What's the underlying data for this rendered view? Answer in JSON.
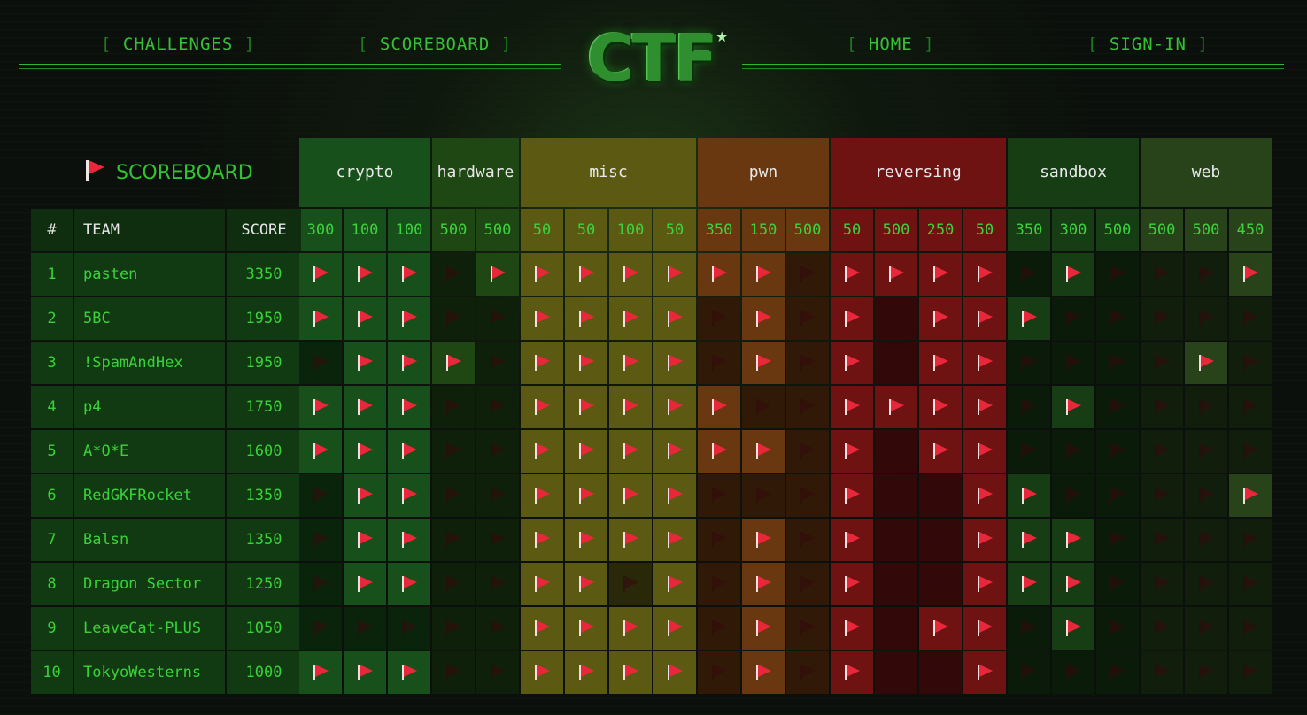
{
  "header": {
    "nav_left": [
      "CHALLENGES",
      "SCOREBOARD"
    ],
    "nav_right": [
      "HOME",
      "SIGN-IN"
    ],
    "logo_text": "CTF",
    "bracket_open": "[",
    "bracket_close": "]"
  },
  "scoreboard": {
    "title": "SCOREBOARD",
    "flag_icon": "red-flag-icon",
    "columns": {
      "rank": "#",
      "team": "TEAM",
      "score": "SCORE"
    },
    "categories": [
      {
        "name": "crypto",
        "points": [
          300,
          100,
          100
        ]
      },
      {
        "name": "hardware",
        "points": [
          500,
          500
        ]
      },
      {
        "name": "misc",
        "points": [
          50,
          50,
          100,
          50
        ]
      },
      {
        "name": "pwn",
        "points": [
          350,
          150,
          500
        ]
      },
      {
        "name": "reversing",
        "points": [
          50,
          500,
          250,
          50
        ]
      },
      {
        "name": "sandbox",
        "points": [
          350,
          300,
          500
        ]
      },
      {
        "name": "web",
        "points": [
          500,
          500,
          450
        ]
      }
    ],
    "rows": [
      {
        "rank": "1",
        "team": "pasten",
        "score": "3350",
        "solved": [
          1,
          1,
          1,
          0,
          1,
          1,
          1,
          1,
          1,
          1,
          1,
          0,
          1,
          1,
          1,
          1,
          0,
          1,
          0,
          0,
          0,
          1
        ]
      },
      {
        "rank": "2",
        "team": "5BC",
        "score": "1950",
        "solved": [
          1,
          1,
          1,
          0,
          0,
          1,
          1,
          1,
          1,
          0,
          1,
          0,
          1,
          0,
          1,
          1,
          1,
          0,
          0,
          0,
          0,
          0
        ]
      },
      {
        "rank": "3",
        "team": "!SpamAndHex",
        "score": "1950",
        "solved": [
          0,
          1,
          1,
          1,
          0,
          1,
          1,
          1,
          1,
          0,
          1,
          0,
          1,
          0,
          1,
          1,
          0,
          0,
          0,
          0,
          1,
          0
        ]
      },
      {
        "rank": "4",
        "team": "p4",
        "score": "1750",
        "solved": [
          1,
          1,
          1,
          0,
          0,
          1,
          1,
          1,
          1,
          1,
          0,
          0,
          1,
          1,
          1,
          1,
          0,
          1,
          0,
          0,
          0,
          0
        ]
      },
      {
        "rank": "5",
        "team": "A*O*E",
        "score": "1600",
        "solved": [
          1,
          1,
          1,
          0,
          0,
          1,
          1,
          1,
          1,
          1,
          1,
          0,
          1,
          0,
          1,
          1,
          0,
          0,
          0,
          0,
          0,
          0
        ]
      },
      {
        "rank": "6",
        "team": "RedGKFRocket",
        "score": "1350",
        "solved": [
          0,
          1,
          1,
          0,
          0,
          1,
          1,
          1,
          1,
          0,
          0,
          0,
          1,
          0,
          0,
          1,
          1,
          0,
          0,
          0,
          0,
          1
        ]
      },
      {
        "rank": "7",
        "team": "Balsn",
        "score": "1350",
        "solved": [
          0,
          1,
          1,
          0,
          0,
          1,
          1,
          1,
          1,
          0,
          1,
          0,
          1,
          0,
          0,
          1,
          1,
          1,
          0,
          0,
          0,
          0
        ]
      },
      {
        "rank": "8",
        "team": "Dragon Sector",
        "score": "1250",
        "solved": [
          0,
          1,
          1,
          0,
          0,
          1,
          1,
          0,
          1,
          0,
          1,
          0,
          1,
          0,
          0,
          1,
          1,
          1,
          0,
          0,
          0,
          0
        ]
      },
      {
        "rank": "9",
        "team": "LeaveCat-PLUS",
        "score": "1050",
        "solved": [
          0,
          0,
          0,
          0,
          0,
          1,
          1,
          1,
          1,
          0,
          1,
          0,
          1,
          0,
          1,
          1,
          0,
          1,
          0,
          0,
          0,
          0
        ]
      },
      {
        "rank": "10",
        "team": "TokyoWesterns",
        "score": "1000",
        "solved": [
          1,
          1,
          1,
          0,
          0,
          1,
          1,
          1,
          1,
          0,
          1,
          0,
          1,
          0,
          0,
          1,
          0,
          0,
          0,
          0,
          0,
          0
        ]
      }
    ]
  },
  "theme_colors": {
    "accent_green": "#3ad13a",
    "flag_red": "#e8283a",
    "crypto": "#17501a",
    "hardware": "#1f4714",
    "misc": "#5c5a12",
    "pwn": "#6a3810",
    "reversing": "#6e1212",
    "sandbox": "#163d14",
    "web": "#28431a"
  }
}
